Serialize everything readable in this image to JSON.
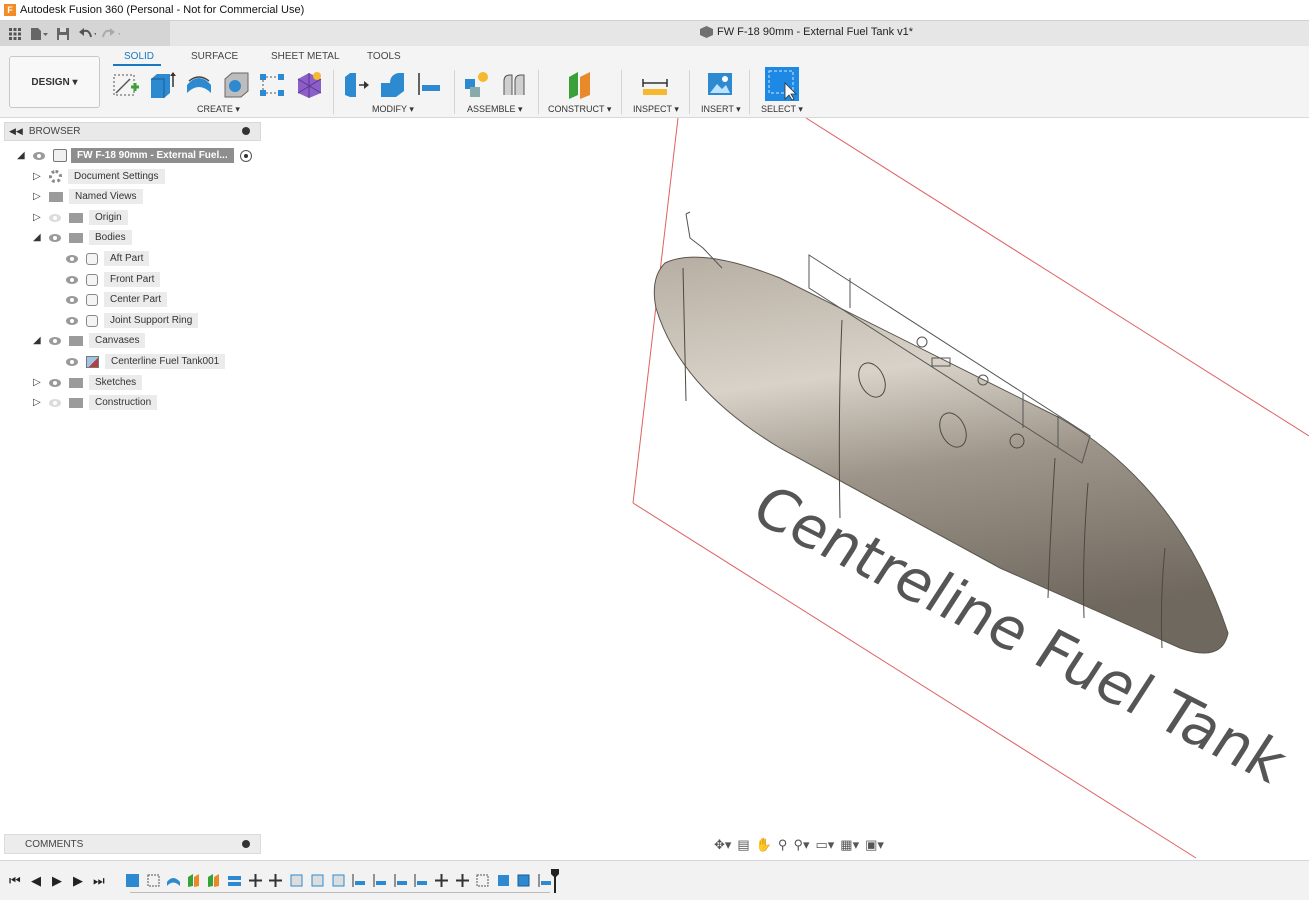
{
  "window": {
    "app_title": "Autodesk Fusion 360 (Personal - Not for Commercial Use)",
    "app_logo_letter": "F"
  },
  "quick_access": {
    "document_title": "FW F-18 90mm - External Fuel Tank v1*",
    "icons": [
      "grid-icon",
      "file-icon",
      "save-icon",
      "undo-icon",
      "redo-icon"
    ]
  },
  "toolbar": {
    "workspace_button": "DESIGN ▾",
    "tabs": [
      "SOLID",
      "SURFACE",
      "SHEET METAL",
      "TOOLS"
    ],
    "active_tab": "SOLID",
    "groups": [
      "CREATE ▾",
      "MODIFY ▾",
      "ASSEMBLE ▾",
      "CONSTRUCT ▾",
      "INSPECT ▾",
      "INSERT ▾",
      "SELECT ▾"
    ],
    "accent_color": "#1a78c2"
  },
  "browser": {
    "title": "BROWSER",
    "root_label": "FW F-18 90mm - External Fuel...",
    "items": [
      {
        "label": "Document Settings"
      },
      {
        "label": "Named Views"
      },
      {
        "label": "Origin"
      },
      {
        "label": "Bodies"
      },
      {
        "label": "Aft Part"
      },
      {
        "label": "Front Part"
      },
      {
        "label": "Center Part"
      },
      {
        "label": "Joint Support Ring"
      },
      {
        "label": "Canvases"
      },
      {
        "label": "Centerline Fuel Tank001"
      },
      {
        "label": "Sketches"
      },
      {
        "label": "Construction"
      }
    ]
  },
  "canvas": {
    "text": "Centreline Fuel Tank"
  },
  "comments": {
    "title": "COMMENTS"
  }
}
